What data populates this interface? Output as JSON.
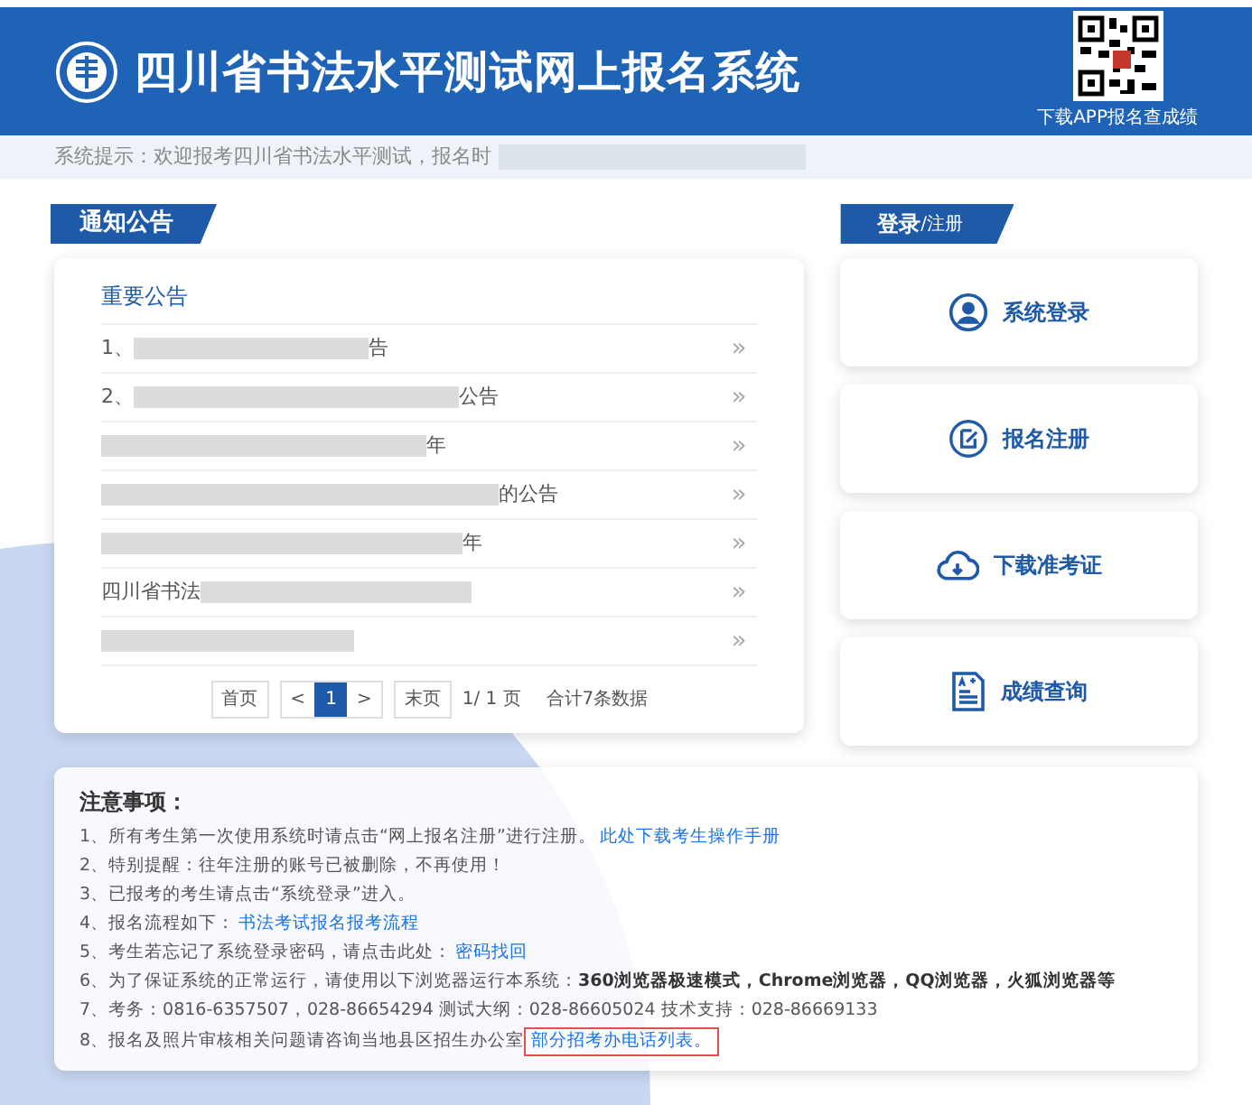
{
  "header": {
    "title": "四川省书法水平测试网上报名系统",
    "qr_caption": "下载APP报名查成绩"
  },
  "hint": {
    "text": "系统提示：欢迎报考四川省书法水平测试，报名时"
  },
  "notices": {
    "tab": "通知公告",
    "heading": "重要公告",
    "items": [
      {
        "lead": "1、",
        "tail": "告",
        "arrow": "»"
      },
      {
        "lead": "2、",
        "tail": "公告",
        "arrow": "»"
      },
      {
        "tail": "年",
        "arrow": "»"
      },
      {
        "tail": "的公告",
        "arrow": "»"
      },
      {
        "tail": "年",
        "arrow": "»"
      },
      {
        "lead": "四川省书法",
        "arrow": "»"
      },
      {
        "arrow": "»"
      }
    ],
    "pager": {
      "first": "首页",
      "prev": "<",
      "pages": [
        {
          "label": "1",
          "selected": true
        }
      ],
      "next": ">",
      "last": "末页",
      "page_info": "1/ 1 页",
      "total": "合计7条数据"
    }
  },
  "login": {
    "tab": "登录",
    "tab_small": "/注册",
    "buttons": [
      {
        "kind": "user",
        "label": "系统登录"
      },
      {
        "kind": "edit",
        "label": "报名注册"
      },
      {
        "kind": "download",
        "label": "下载准考证"
      },
      {
        "kind": "grade",
        "label": "成绩查询"
      }
    ]
  },
  "notes": {
    "title": "注意事项：",
    "items": [
      {
        "text": "1、所有考生第一次使用系统时请点击“网上报名注册”进行注册。",
        "link": "此处下载考生操作手册",
        "boxed": false
      },
      {
        "text": "2、特别提醒：往年注册的账号已被删除，不再使用！"
      },
      {
        "text": "3、已报考的考生请点击“系统登录”进入。"
      },
      {
        "text": "4、报名流程如下：",
        "link": "书法考试报名报考流程",
        "boxed": false
      },
      {
        "text": "5、考生若忘记了系统登录密码，请点击此处：",
        "link": "密码找回",
        "boxed": false
      },
      {
        "text": "6、为了保证系统的正常运行，请使用以下浏览器运行本系统：**360浏览器极速模式，Chrome浏览器，QQ浏览器，火狐浏览器等**"
      },
      {
        "text": "7、考务：0816-6357507，028-86654294 测试大纲：028-86605024 技术支持：028-86669133"
      },
      {
        "text": "8、报名及照片审核相关问题请咨询当地县区招生办公室",
        "link": "部分招考办电话列表。",
        "boxed": true
      }
    ]
  }
}
